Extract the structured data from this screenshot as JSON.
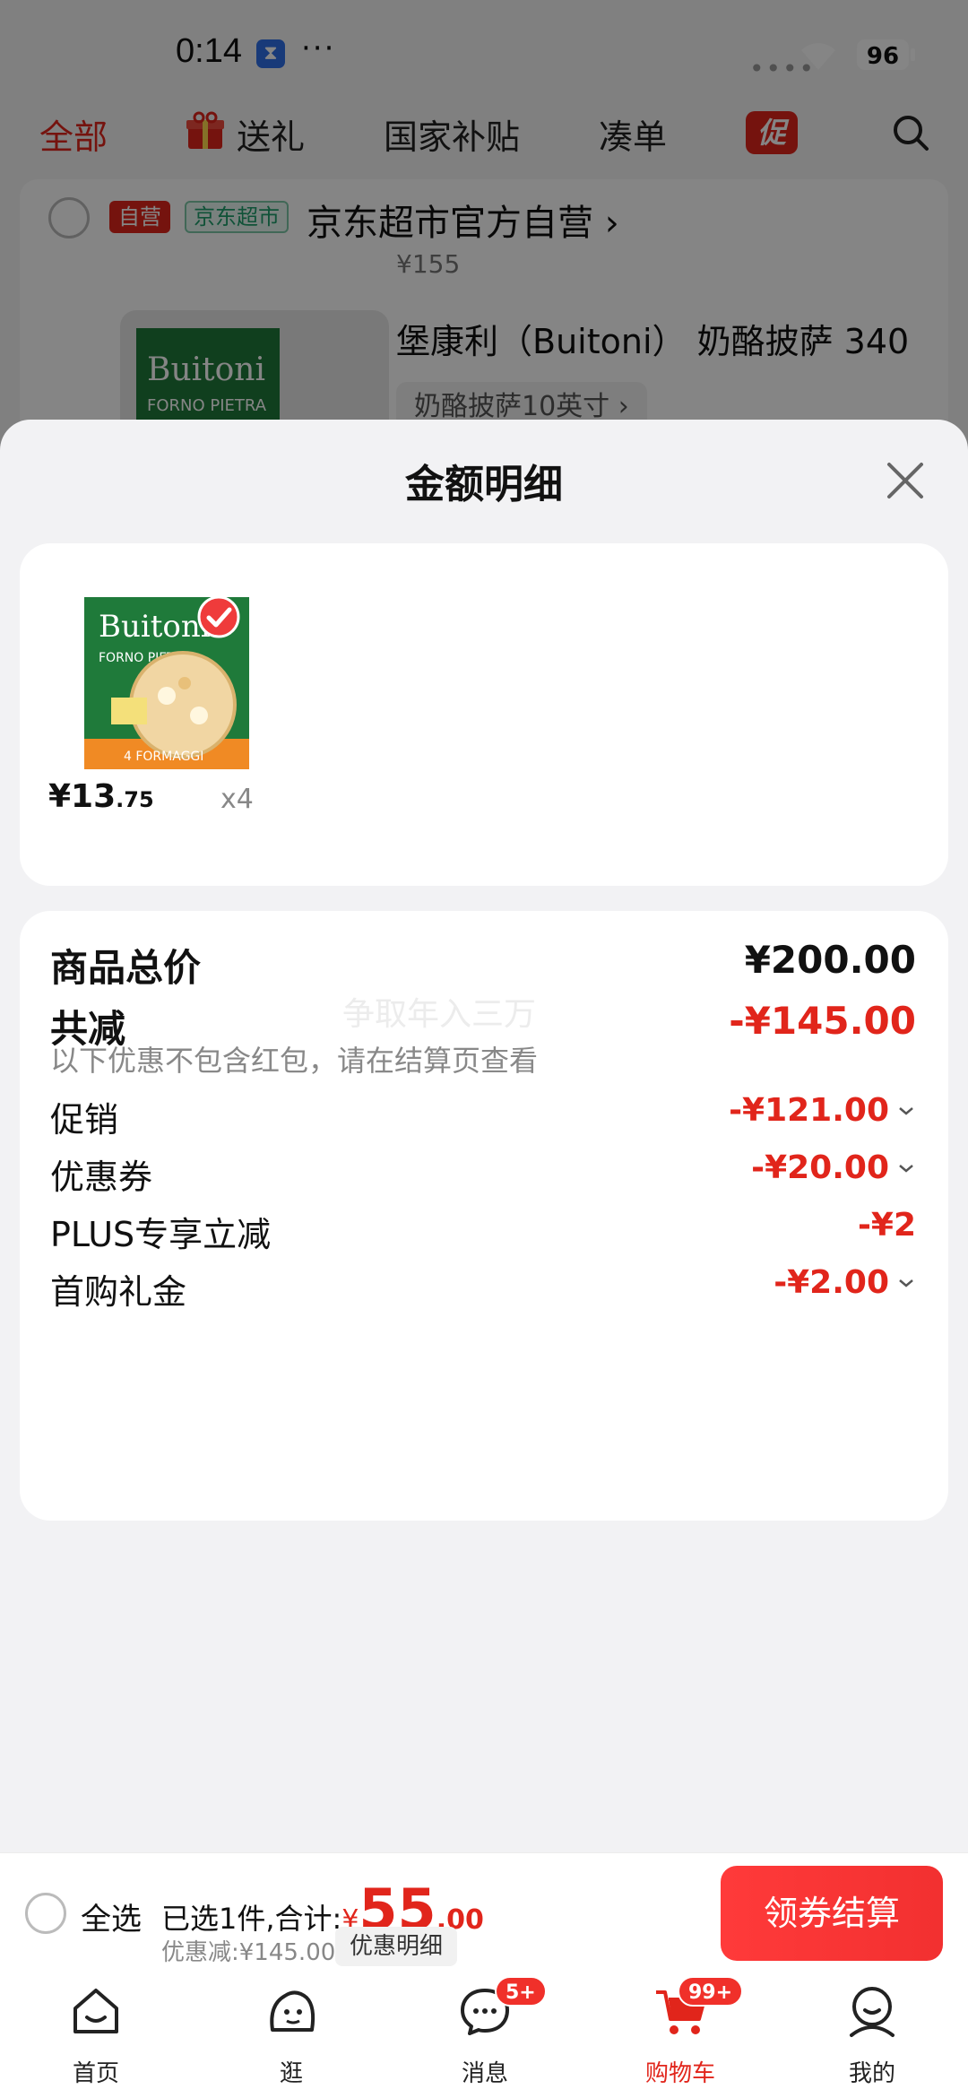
{
  "status_bar": {
    "time": "0:14",
    "battery": "96"
  },
  "top_tabs": [
    {
      "label": "全部"
    },
    {
      "label": "送礼"
    },
    {
      "label": "国家补贴"
    },
    {
      "label": "凑单"
    },
    {
      "label": "促"
    }
  ],
  "store": {
    "self_tag": "自营",
    "market_tag": "京东超市",
    "name": "京东超市官方自营 ›",
    "price_hint": "¥155",
    "product_title": "堡康利（Buitoni） 奶酪披萨 340",
    "product_spec": "奶酪披萨10英寸 ›"
  },
  "sheet": {
    "title": "金额明细",
    "item": {
      "price_int": "¥13",
      "price_dec": ".75",
      "qty": "x4"
    },
    "total": {
      "label": "商品总价",
      "amount": "¥200.00"
    },
    "reduce": {
      "label": "共减",
      "amount": "-¥145.00",
      "note": "以下优惠不包含红包，请在结算页查看"
    },
    "watermark": "争取年入三万",
    "discounts": [
      {
        "label": "促销",
        "amount": "-¥121.00"
      },
      {
        "label": "优惠券",
        "amount": "-¥20.00"
      },
      {
        "label": "PLUS专享立减",
        "amount": "-¥2"
      },
      {
        "label": "首购礼金",
        "amount": "-¥2.00"
      }
    ]
  },
  "checkout": {
    "select_all": "全选",
    "selected_text": "已选1件,合计:",
    "currency": "¥",
    "total_int": "55",
    "total_dec": ".00",
    "discount_text": "优惠减:¥145.00",
    "detail_chip": "优惠明细",
    "button": "领券结算"
  },
  "tab_bar": [
    {
      "label": "首页"
    },
    {
      "label": "逛"
    },
    {
      "label": "消息",
      "badge": "5+"
    },
    {
      "label": "购物车",
      "badge": "99+"
    },
    {
      "label": "我的"
    }
  ],
  "colors": {
    "accent": "#e1251b",
    "sheet_bg": "#f2f2f4"
  }
}
